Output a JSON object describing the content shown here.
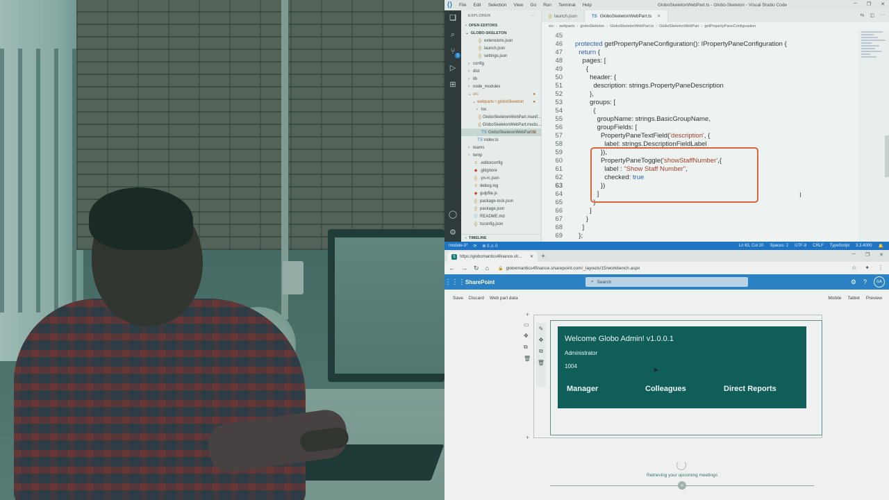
{
  "vscode": {
    "window_title": "GloboSkeletonWebPart.ts - Globo-Skeleton - Visual Studio Code",
    "menu": [
      "File",
      "Edit",
      "Selection",
      "View",
      "Go",
      "Run",
      "Terminal",
      "Help"
    ],
    "explorer": {
      "header": "EXPLORER",
      "open_editors": "OPEN EDITORS",
      "project": "GLOBO-SKELETON",
      "timeline": "TIMELINE",
      "files": [
        {
          "name": "extensions.json",
          "type": "json",
          "indent": 2
        },
        {
          "name": "launch.json",
          "type": "json",
          "indent": 2
        },
        {
          "name": "settings.json",
          "type": "json",
          "indent": 2
        },
        {
          "name": "config",
          "type": "folder",
          "indent": 1
        },
        {
          "name": "dist",
          "type": "folder",
          "indent": 1
        },
        {
          "name": "lib",
          "type": "folder",
          "indent": 1
        },
        {
          "name": "node_modules",
          "type": "folder",
          "indent": 1
        },
        {
          "name": "src",
          "type": "folder-open",
          "indent": 1,
          "mark": "●"
        },
        {
          "name": "webparts \\ globoSkeleton",
          "type": "folder-open",
          "indent": 2,
          "mark": "●"
        },
        {
          "name": "loc",
          "type": "folder",
          "indent": 3
        },
        {
          "name": "GloboSkeletonWebPart.manif...",
          "type": "json",
          "indent": 3
        },
        {
          "name": "GloboSkeletonWebPart.modu...",
          "type": "json",
          "indent": 3
        },
        {
          "name": "GloboSkeletonWebPart.ts",
          "type": "ts",
          "indent": 3,
          "mark": "M",
          "selected": true
        },
        {
          "name": "index.ts",
          "type": "ts",
          "indent": 2
        },
        {
          "name": "teams",
          "type": "folder",
          "indent": 1
        },
        {
          "name": "temp",
          "type": "folder",
          "indent": 1
        },
        {
          "name": ".editorconfig",
          "type": "cfg",
          "indent": 1
        },
        {
          "name": ".gitignore",
          "type": "git",
          "indent": 1
        },
        {
          "name": ".yo-rc.json",
          "type": "json",
          "indent": 1
        },
        {
          "name": "debug.log",
          "type": "cfg",
          "indent": 1
        },
        {
          "name": "gulpfile.js",
          "type": "gulp",
          "indent": 1
        },
        {
          "name": "package-lock.json",
          "type": "json",
          "indent": 1
        },
        {
          "name": "package.json",
          "type": "json",
          "indent": 1
        },
        {
          "name": "README.md",
          "type": "md",
          "indent": 1
        },
        {
          "name": "tsconfig.json",
          "type": "json",
          "indent": 1
        }
      ]
    },
    "tabs": [
      {
        "label": "launch.json",
        "type": "json",
        "active": false
      },
      {
        "label": "GloboSkeletonWebPart.ts",
        "type": "ts",
        "active": true
      }
    ],
    "breadcrumb": [
      "src",
      "webparts",
      "globoSkeleton",
      "GloboSkeletonWebPart.ts",
      "GloboSkeletonWebPart",
      "getPropertyPaneConfiguration"
    ],
    "code_lines": [
      {
        "n": "45",
        "text": ""
      },
      {
        "n": "46",
        "html": "<span class='kw'>protected</span> getPropertyPaneConfiguration(): IPropertyPaneConfiguration {"
      },
      {
        "n": "47",
        "html": "  <span class='kw'>return</span> {"
      },
      {
        "n": "48",
        "text": "    pages: ["
      },
      {
        "n": "49",
        "text": "      {"
      },
      {
        "n": "50",
        "text": "        header: {"
      },
      {
        "n": "51",
        "text": "          description: strings.PropertyPaneDescription"
      },
      {
        "n": "52",
        "text": "        },"
      },
      {
        "n": "53",
        "text": "        groups: ["
      },
      {
        "n": "54",
        "text": "          {"
      },
      {
        "n": "55",
        "text": "            groupName: strings.BasicGroupName,"
      },
      {
        "n": "56",
        "text": "            groupFields: ["
      },
      {
        "n": "57",
        "html": "              PropertyPaneTextField(<span class='str'>'description'</span>, {"
      },
      {
        "n": "58",
        "text": "                label: strings.DescriptionFieldLabel"
      },
      {
        "n": "59",
        "text": "              }),"
      },
      {
        "n": "60",
        "html": "              PropertyPaneToggle(<span class='str'>'showStaffNumber'</span>,{"
      },
      {
        "n": "61",
        "html": "                label : <span class='str'>\"Show Staff Number\"</span>,"
      },
      {
        "n": "62",
        "html": "                checked: <span class='kw'>true</span>"
      },
      {
        "n": "63",
        "text": "              })"
      },
      {
        "n": "64",
        "text": "            ]"
      },
      {
        "n": "65",
        "text": "          }"
      },
      {
        "n": "66",
        "text": "        ]"
      },
      {
        "n": "67",
        "text": "      }"
      },
      {
        "n": "68",
        "text": "    ]"
      },
      {
        "n": "69",
        "text": "  };"
      }
    ],
    "status": {
      "branch": "module-3*",
      "sync": "⟳",
      "problems": "⊗ 0 ⚠ 0",
      "position": "Ln 63, Col 20",
      "spaces": "Spaces: 2",
      "encoding": "UTF-8",
      "eol": "CRLF",
      "language": "TypeScript",
      "version": "3.3.4000"
    }
  },
  "browser": {
    "tab_title": "https://globomantics4finance.sh...",
    "url": "globomantics4finance.sharepoint.com/_layouts/15/workbench.aspx",
    "sharepoint": {
      "brand": "SharePoint",
      "search_placeholder": "Search",
      "avatar": "GA"
    },
    "workbench": {
      "left_commands": [
        "Save",
        "Discard",
        "Web part data"
      ],
      "right_commands": [
        "Mobile",
        "Tablet",
        "Preview"
      ]
    },
    "webpart": {
      "welcome": "Welcome Globo Admin! v1.0.0.1",
      "role": "Administrator",
      "staff_number": "1004",
      "links": [
        "Manager",
        "Colleagues",
        "Direct Reports"
      ],
      "loading": "Retrieving your upcoming meetings"
    }
  },
  "colors": {
    "accent_blue": "#1f74c4",
    "sharepoint_blue": "#2a82c4",
    "webpart_teal": "#0f5e5a",
    "highlight_orange": "#d9653a"
  }
}
